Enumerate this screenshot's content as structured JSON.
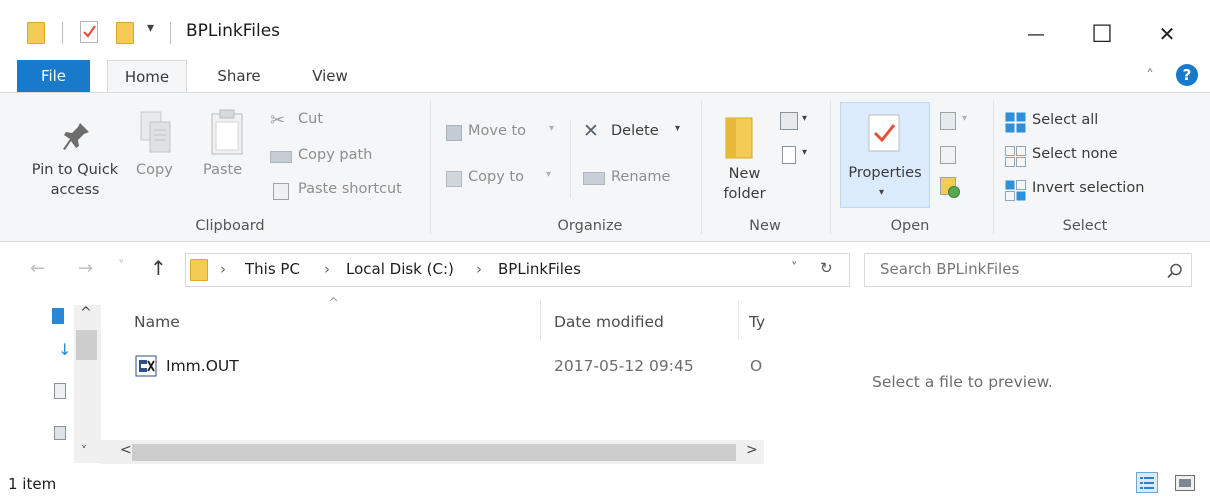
{
  "window": {
    "title": "BPLinkFiles",
    "quick_access_dropdown": "▾",
    "minimize_glyph": "—",
    "maximize_glyph": "☐",
    "close_glyph": "✕"
  },
  "tabs": {
    "file": "File",
    "home": "Home",
    "share": "Share",
    "view": "View",
    "collapse_glyph": "˄",
    "help_glyph": "?"
  },
  "ribbon": {
    "clipboard": {
      "pin_line1": "Pin to Quick",
      "pin_line2": "access",
      "copy": "Copy",
      "paste": "Paste",
      "cut": "Cut",
      "copy_path": "Copy path",
      "paste_shortcut": "Paste shortcut",
      "label": "Clipboard"
    },
    "organize": {
      "move_to": "Move to",
      "copy_to": "Copy to",
      "delete": "Delete",
      "rename": "Rename",
      "label": "Organize"
    },
    "new": {
      "new_folder_line1": "New",
      "new_folder_line2": "folder",
      "label": "New"
    },
    "open": {
      "properties": "Properties",
      "label": "Open"
    },
    "select": {
      "select_all": "Select all",
      "select_none": "Select none",
      "invert_selection": "Invert selection",
      "label": "Select"
    }
  },
  "nav": {
    "back": "←",
    "forward": "→",
    "recent": "˅",
    "up": "↑",
    "breadcrumb": [
      "This PC",
      "Local Disk (C:)",
      "BPLinkFiles"
    ],
    "breadcrumb_sep": "›",
    "dropdown_glyph": "˅",
    "refresh_glyph": "↻",
    "search_placeholder": "Search BPLinkFiles"
  },
  "file_list": {
    "columns": [
      "Name",
      "Date modified",
      "Ty"
    ],
    "sort_glyph": "^",
    "rows": [
      {
        "name": "Imm.OUT",
        "date_modified": "2017-05-12 09:45",
        "type": "O"
      }
    ]
  },
  "scroll": {
    "up": "^",
    "down": "˅",
    "left": "<",
    "right": ">"
  },
  "preview": {
    "message": "Select a file to preview."
  },
  "status": {
    "item_count": "1 item"
  },
  "colors": {
    "accent": "#1979ca",
    "folder": "#f4cb55",
    "ribbon_bg": "#f5f6f7"
  }
}
